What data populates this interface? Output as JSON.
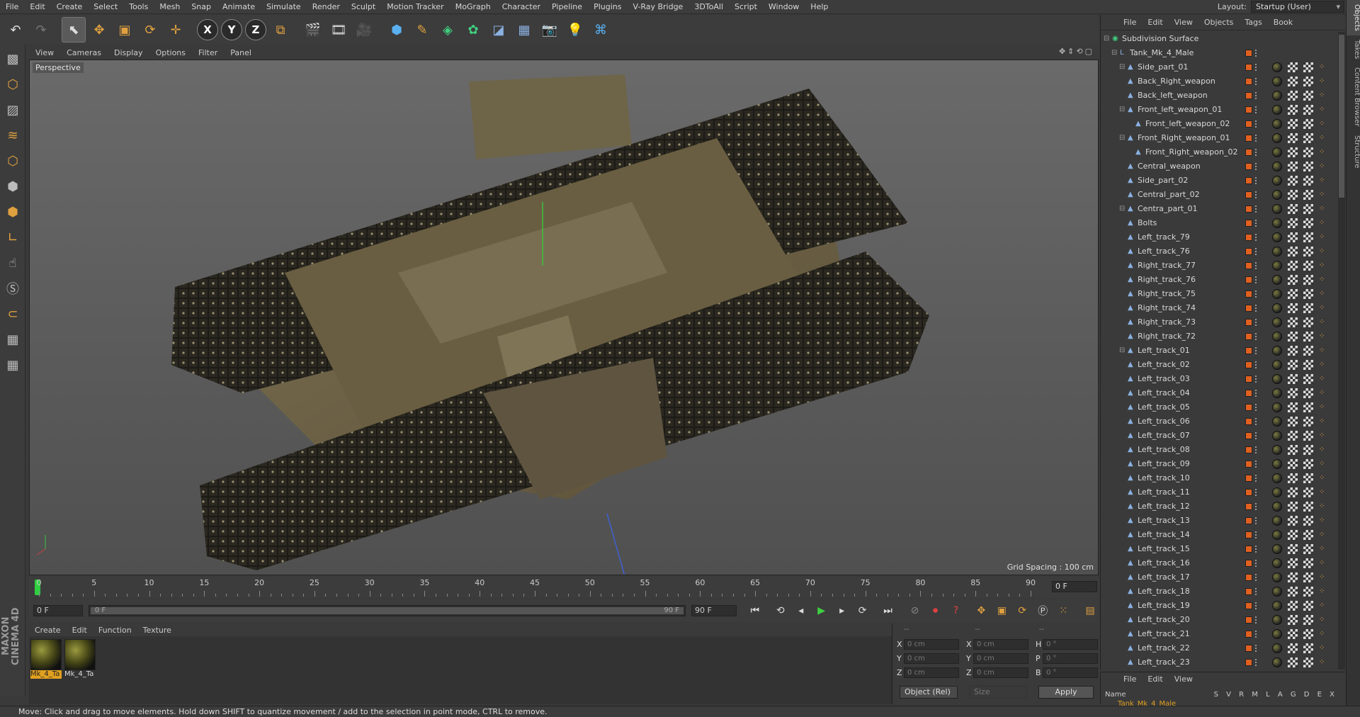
{
  "menubar": {
    "items": [
      "File",
      "Edit",
      "Create",
      "Select",
      "Tools",
      "Mesh",
      "Snap",
      "Animate",
      "Simulate",
      "Render",
      "Sculpt",
      "Motion Tracker",
      "MoGraph",
      "Character",
      "Pipeline",
      "Plugins",
      "V-Ray Bridge",
      "3DToAll",
      "Script",
      "Window",
      "Help"
    ],
    "layout_label": "Layout:",
    "layout_value": "Startup (User)"
  },
  "toolbar": {
    "axis_x": "X",
    "axis_y": "Y",
    "axis_z": "Z"
  },
  "viewport": {
    "menu": [
      "View",
      "Cameras",
      "Display",
      "Options",
      "Filter",
      "Panel"
    ],
    "label": "Perspective",
    "grid_spacing": "Grid Spacing : 100 cm"
  },
  "timeline": {
    "ticks": [
      "0",
      "5",
      "10",
      "15",
      "20",
      "25",
      "30",
      "35",
      "40",
      "45",
      "50",
      "55",
      "60",
      "65",
      "70",
      "75",
      "80",
      "85",
      "90"
    ],
    "frame_box": "0 F"
  },
  "transport": {
    "start_field": "0 F",
    "range_start": "0 F",
    "range_end": "90 F",
    "end_field": "90 F"
  },
  "materials": {
    "menu": [
      "Create",
      "Edit",
      "Function",
      "Texture"
    ],
    "items": [
      {
        "name": "Mk_4_Ta",
        "selected": true
      },
      {
        "name": "Mk_4_Ta",
        "selected": false
      }
    ]
  },
  "coordinates": {
    "header_left": "--",
    "header_mid": "--",
    "header_right": "--",
    "rows": [
      {
        "a": "X",
        "av": "0 cm",
        "b": "X",
        "bv": "0 cm",
        "c": "H",
        "cv": "0 °"
      },
      {
        "a": "Y",
        "av": "0 cm",
        "b": "Y",
        "bv": "0 cm",
        "c": "P",
        "cv": "0 °"
      },
      {
        "a": "Z",
        "av": "0 cm",
        "b": "Z",
        "bv": "0 cm",
        "c": "B",
        "cv": "0 °"
      }
    ],
    "mode_select": "Object (Rel)",
    "size_select": "Size",
    "apply_label": "Apply"
  },
  "object_manager": {
    "menu": [
      "File",
      "Edit",
      "View",
      "Objects",
      "Tags",
      "Book"
    ],
    "objects": [
      {
        "name": "Subdivision Surface",
        "depth": 0,
        "kind": "sds"
      },
      {
        "name": "Tank_Mk_4_Male",
        "depth": 1,
        "kind": "null"
      },
      {
        "name": "Side_part_01",
        "depth": 2
      },
      {
        "name": "Back_Right_weapon",
        "depth": 2
      },
      {
        "name": "Back_left_weapon",
        "depth": 2
      },
      {
        "name": "Front_left_weapon_01",
        "depth": 2
      },
      {
        "name": "Front_left_weapon_02",
        "depth": 3
      },
      {
        "name": "Front_Right_weapon_01",
        "depth": 2
      },
      {
        "name": "Front_Right_weapon_02",
        "depth": 3
      },
      {
        "name": "Central_weapon",
        "depth": 2
      },
      {
        "name": "Side_part_02",
        "depth": 2
      },
      {
        "name": "Central_part_02",
        "depth": 2
      },
      {
        "name": "Centra_part_01",
        "depth": 2
      },
      {
        "name": "Bolts",
        "depth": 2
      },
      {
        "name": "Left_track_79",
        "depth": 2
      },
      {
        "name": "Left_track_76",
        "depth": 2
      },
      {
        "name": "Right_track_77",
        "depth": 2
      },
      {
        "name": "Right_track_76",
        "depth": 2
      },
      {
        "name": "Right_track_75",
        "depth": 2
      },
      {
        "name": "Right_track_74",
        "depth": 2
      },
      {
        "name": "Right_track_73",
        "depth": 2
      },
      {
        "name": "Right_track_72",
        "depth": 2
      },
      {
        "name": "Left_track_01",
        "depth": 2
      },
      {
        "name": "Left_track_02",
        "depth": 2
      },
      {
        "name": "Left_track_03",
        "depth": 2
      },
      {
        "name": "Left_track_04",
        "depth": 2
      },
      {
        "name": "Left_track_05",
        "depth": 2
      },
      {
        "name": "Left_track_06",
        "depth": 2
      },
      {
        "name": "Left_track_07",
        "depth": 2
      },
      {
        "name": "Left_track_08",
        "depth": 2
      },
      {
        "name": "Left_track_09",
        "depth": 2
      },
      {
        "name": "Left_track_10",
        "depth": 2
      },
      {
        "name": "Left_track_11",
        "depth": 2
      },
      {
        "name": "Left_track_12",
        "depth": 2
      },
      {
        "name": "Left_track_13",
        "depth": 2
      },
      {
        "name": "Left_track_14",
        "depth": 2
      },
      {
        "name": "Left_track_15",
        "depth": 2
      },
      {
        "name": "Left_track_16",
        "depth": 2
      },
      {
        "name": "Left_track_17",
        "depth": 2
      },
      {
        "name": "Left_track_18",
        "depth": 2
      },
      {
        "name": "Left_track_19",
        "depth": 2
      },
      {
        "name": "Left_track_20",
        "depth": 2
      },
      {
        "name": "Left_track_21",
        "depth": 2
      },
      {
        "name": "Left_track_22",
        "depth": 2
      },
      {
        "name": "Left_track_23",
        "depth": 2
      }
    ]
  },
  "side_tabs": [
    "Objects",
    "Takes",
    "Content Browser",
    "Structure"
  ],
  "layers": {
    "menu": [
      "File",
      "Edit",
      "View"
    ],
    "name_header": "Name",
    "columns": "S V R M L A G D E X",
    "row_name": "Tank_Mk_4_Male"
  },
  "status": {
    "text": "Move: Click and drag to move elements. Hold down SHIFT to quantize movement / add to the selection in point mode, CTRL to remove."
  },
  "colors": {
    "accent": "#e0a020",
    "play": "#3ed040",
    "visibility": "#e06020"
  }
}
